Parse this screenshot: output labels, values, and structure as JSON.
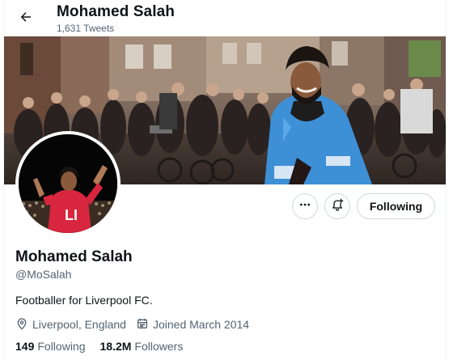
{
  "header": {
    "name": "Mohamed Salah",
    "tweet_count": "1,631 Tweets"
  },
  "profile": {
    "name": "Mohamed Salah",
    "handle": "@MoSalah",
    "bio": "Footballer for Liverpool FC.",
    "location": "Liverpool, England",
    "joined": "Joined March 2014",
    "following_count": "149",
    "following_label": "Following",
    "followers_count": "18.2M",
    "followers_label": "Followers"
  },
  "actions": {
    "follow_button_label": "Following"
  },
  "avatar": {
    "jersey_text": "LI"
  },
  "colors": {
    "text_primary": "#0f1419",
    "text_secondary": "#536471",
    "border": "#cfd9de",
    "jacket": "#3d8fd6",
    "jersey": "#d7263d"
  },
  "icons": {
    "back": "arrow-left-icon",
    "more": "more-horizontal-icon",
    "notify": "bell-plus-icon",
    "location": "location-pin-icon",
    "calendar": "calendar-icon"
  }
}
